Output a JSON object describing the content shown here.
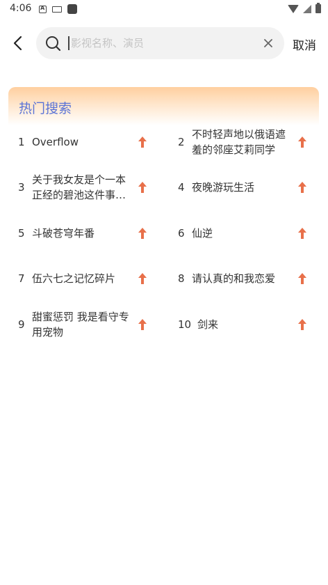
{
  "status_bar": {
    "time": "4:06",
    "icons": [
      "a-notification-icon",
      "keyboard-icon",
      "app-square-icon",
      "wifi-icon",
      "signal-icon",
      "battery-icon"
    ]
  },
  "search": {
    "placeholder": "影视名称、演员",
    "value": "",
    "cancel_label": "取消"
  },
  "hot_search": {
    "title": "热门搜索",
    "accent_color": "#5b74d6",
    "arrow_color": "#e8704a",
    "items": [
      {
        "rank": "1",
        "name": "Overflow"
      },
      {
        "rank": "2",
        "name": "不时轻声地以俄语遮羞的邻座艾莉同学"
      },
      {
        "rank": "3",
        "name": "关于我女友是个一本正经的碧池这件事…"
      },
      {
        "rank": "4",
        "name": "夜晚游玩生活"
      },
      {
        "rank": "5",
        "name": "斗破苍穹年番"
      },
      {
        "rank": "6",
        "name": "仙逆"
      },
      {
        "rank": "7",
        "name": "伍六七之记忆碎片"
      },
      {
        "rank": "8",
        "name": "请认真的和我恋爱"
      },
      {
        "rank": "9",
        "name": "甜蜜惩罚 我是看守专用宠物"
      },
      {
        "rank": "10",
        "name": "剑来"
      }
    ]
  }
}
